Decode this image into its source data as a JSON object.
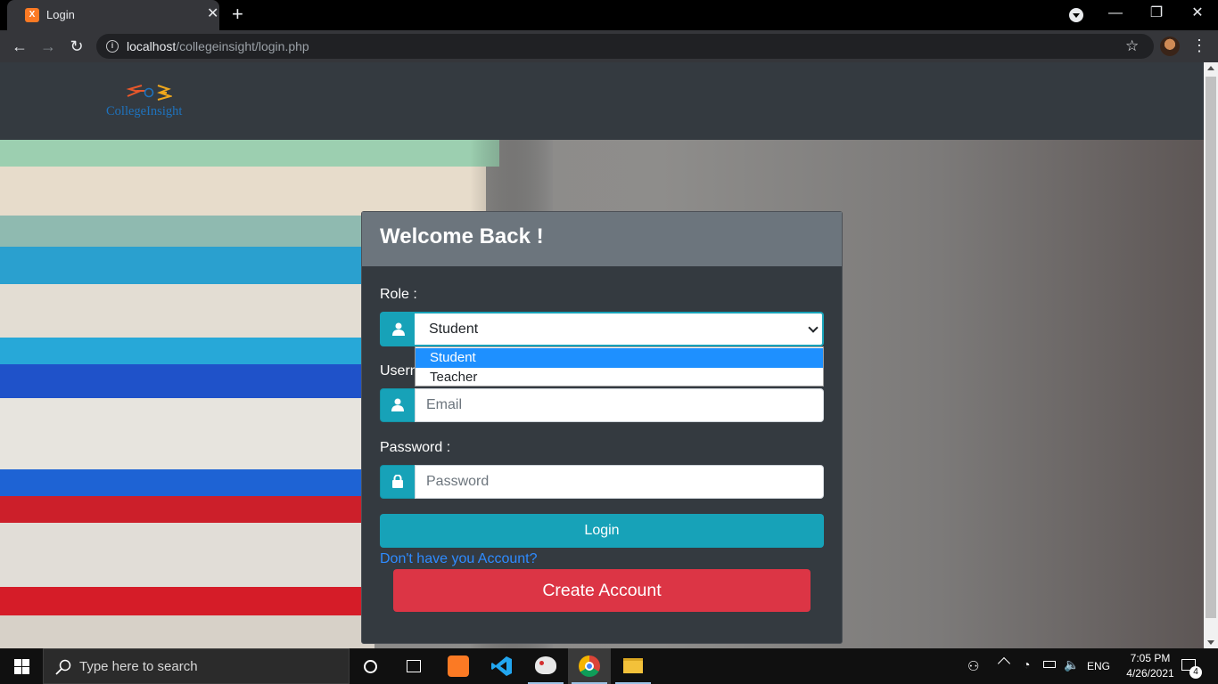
{
  "browser": {
    "tab_title": "Login",
    "favicon_label": "X",
    "tab_close": "✕",
    "new_tab": "+",
    "url_host": "localhost",
    "url_path": "/collegeinsight/login.php",
    "window_controls": [
      "—",
      "❐",
      "✕"
    ],
    "nav": {
      "back": "←",
      "forward": "→",
      "reload": "↻"
    }
  },
  "site": {
    "logo_text": "CollegeInsight"
  },
  "login_card": {
    "title": "Welcome Back !",
    "role_label": "Role :",
    "role_selected": "Student",
    "role_options": [
      "Student",
      "Teacher"
    ],
    "username_label": "Usern",
    "email_placeholder": "Email",
    "password_label": "Password :",
    "password_placeholder": "Password",
    "login_button": "Login",
    "signup_link": "Don't have you Account?",
    "create_button": "Create Account"
  },
  "taskbar": {
    "search_placeholder": "Type here to search",
    "language": "ENG",
    "time": "7:05 PM",
    "date": "4/26/2021",
    "notification_count": "4"
  },
  "colors": {
    "accent": "#17a2b8",
    "danger": "#dc3545",
    "navbar": "#343a40",
    "card_header": "#6c757d"
  }
}
